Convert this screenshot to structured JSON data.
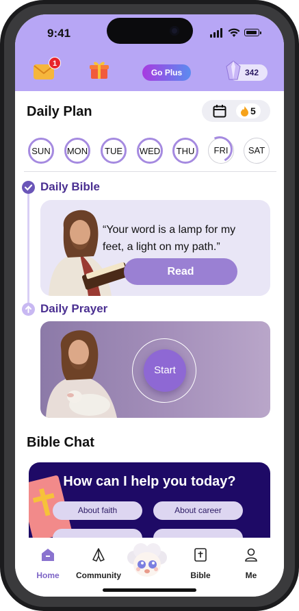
{
  "status_bar": {
    "time": "9:41"
  },
  "header": {
    "mail_badge": "1",
    "go_plus_label": "Go Plus",
    "gems_count": "342"
  },
  "daily_plan": {
    "title": "Daily Plan",
    "streak_count": "5",
    "days": [
      {
        "label": "SUN",
        "state": "complete"
      },
      {
        "label": "MON",
        "state": "complete"
      },
      {
        "label": "TUE",
        "state": "complete"
      },
      {
        "label": "WED",
        "state": "complete"
      },
      {
        "label": "THU",
        "state": "complete"
      },
      {
        "label": "FRI",
        "state": "partial"
      },
      {
        "label": "SAT",
        "state": "empty"
      }
    ]
  },
  "daily_bible": {
    "title": "Daily Bible",
    "quote": "“Your word is a lamp for my feet, a light on my path.”",
    "read_label": "Read"
  },
  "daily_prayer": {
    "title": "Daily Prayer",
    "start_label": "Start"
  },
  "bible_chat": {
    "title": "Bible Chat",
    "prompt": "How can I help you today?",
    "chips": [
      "About faith",
      "About career"
    ]
  },
  "tabbar": {
    "items": [
      {
        "label": "Home",
        "icon": "home-icon",
        "active": true
      },
      {
        "label": "Community",
        "icon": "praying-hands-icon",
        "active": false
      },
      {
        "label": "Bible",
        "icon": "bible-icon",
        "active": false
      },
      {
        "label": "Me",
        "icon": "person-icon",
        "active": false
      }
    ]
  },
  "colors": {
    "header_bg": "#b7a6f5",
    "accent": "#7d64c6",
    "chat_bg": "#1e0a66"
  }
}
